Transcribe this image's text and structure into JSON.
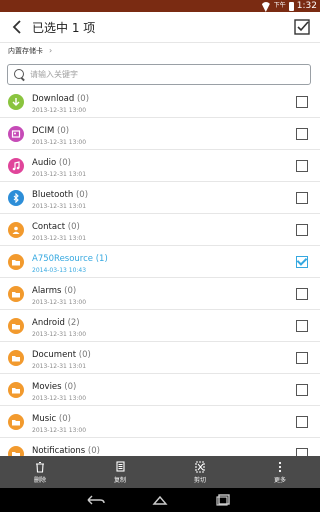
{
  "status_bar": {
    "ampm": "下午",
    "time": "1:32"
  },
  "action_bar": {
    "title": "已选中 1 项"
  },
  "breadcrumb": {
    "path": "内置存储卡"
  },
  "search": {
    "placeholder": "请输入关键字"
  },
  "items": [
    {
      "name": "Download",
      "count": "(0)",
      "date": "2013-12-31 13:00",
      "icon": "download-folder-icon",
      "color": "#8ac43f",
      "selected": false
    },
    {
      "name": "DCIM",
      "count": "(0)",
      "date": "2013-12-31 13:00",
      "icon": "picture-folder-icon",
      "color": "#c64bb7",
      "selected": false
    },
    {
      "name": "Audio",
      "count": "(0)",
      "date": "2013-12-31 13:01",
      "icon": "music-folder-icon",
      "color": "#e0459a",
      "selected": false
    },
    {
      "name": "Bluetooth",
      "count": "(0)",
      "date": "2013-12-31 13:01",
      "icon": "bluetooth-folder-icon",
      "color": "#2d8ed8",
      "selected": false
    },
    {
      "name": "Contact",
      "count": "(0)",
      "date": "2013-12-31 13:01",
      "icon": "contact-folder-icon",
      "color": "#f29a2e",
      "selected": false
    },
    {
      "name": "A750Resource",
      "count": "(1)",
      "date": "2014-03-13 10:43",
      "icon": "folder-icon",
      "color": "#f29a2e",
      "selected": true
    },
    {
      "name": "Alarms",
      "count": "(0)",
      "date": "2013-12-31 13:00",
      "icon": "folder-icon",
      "color": "#f29a2e",
      "selected": false
    },
    {
      "name": "Android",
      "count": "(2)",
      "date": "2013-12-31 13:00",
      "icon": "folder-icon",
      "color": "#f29a2e",
      "selected": false
    },
    {
      "name": "Document",
      "count": "(0)",
      "date": "2013-12-31 13:01",
      "icon": "folder-icon",
      "color": "#f29a2e",
      "selected": false
    },
    {
      "name": "Movies",
      "count": "(0)",
      "date": "2013-12-31 13:00",
      "icon": "folder-icon",
      "color": "#f29a2e",
      "selected": false
    },
    {
      "name": "Music",
      "count": "(0)",
      "date": "2013-12-31 13:00",
      "icon": "folder-icon",
      "color": "#f29a2e",
      "selected": false
    },
    {
      "name": "Notifications",
      "count": "(0)",
      "date": "",
      "icon": "folder-icon",
      "color": "#f29a2e",
      "selected": false
    }
  ],
  "bottom_actions": [
    {
      "label": "删除",
      "icon": "trash-icon"
    },
    {
      "label": "复制",
      "icon": "copy-icon"
    },
    {
      "label": "剪切",
      "icon": "cut-icon"
    },
    {
      "label": "更多",
      "icon": "more-icon"
    }
  ]
}
